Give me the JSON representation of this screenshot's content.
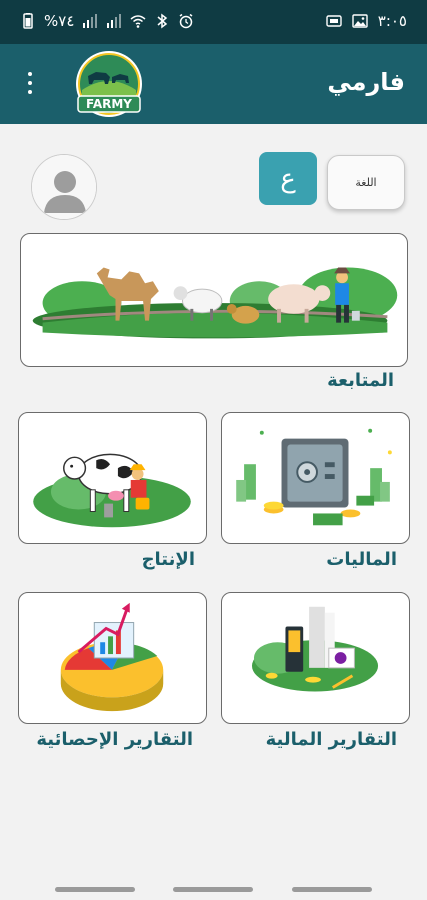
{
  "status_bar": {
    "time": "٣:٠٥",
    "battery": "%٧٤",
    "icons": [
      "battery-icon",
      "signal-icon",
      "signal-icon",
      "wifi-icon",
      "bluetooth-icon",
      "alarm-icon",
      "gallery-icon",
      "sim-icon"
    ]
  },
  "app_bar": {
    "title": "فارمي",
    "logo_text": "FARMY"
  },
  "language": {
    "label": "اللغة",
    "current": "ع"
  },
  "sections": {
    "tracking": "المتابعة",
    "production": "الإنتاج",
    "finances": "الماليات",
    "statistical_reports": "التقارير الإحصائية",
    "financial_reports": "التقارير المالية"
  },
  "colors": {
    "app_bar": "#1b5f6b",
    "status_bar": "#0f3b43",
    "accent": "#3aa1b0",
    "label_text": "#1b5f6b"
  }
}
